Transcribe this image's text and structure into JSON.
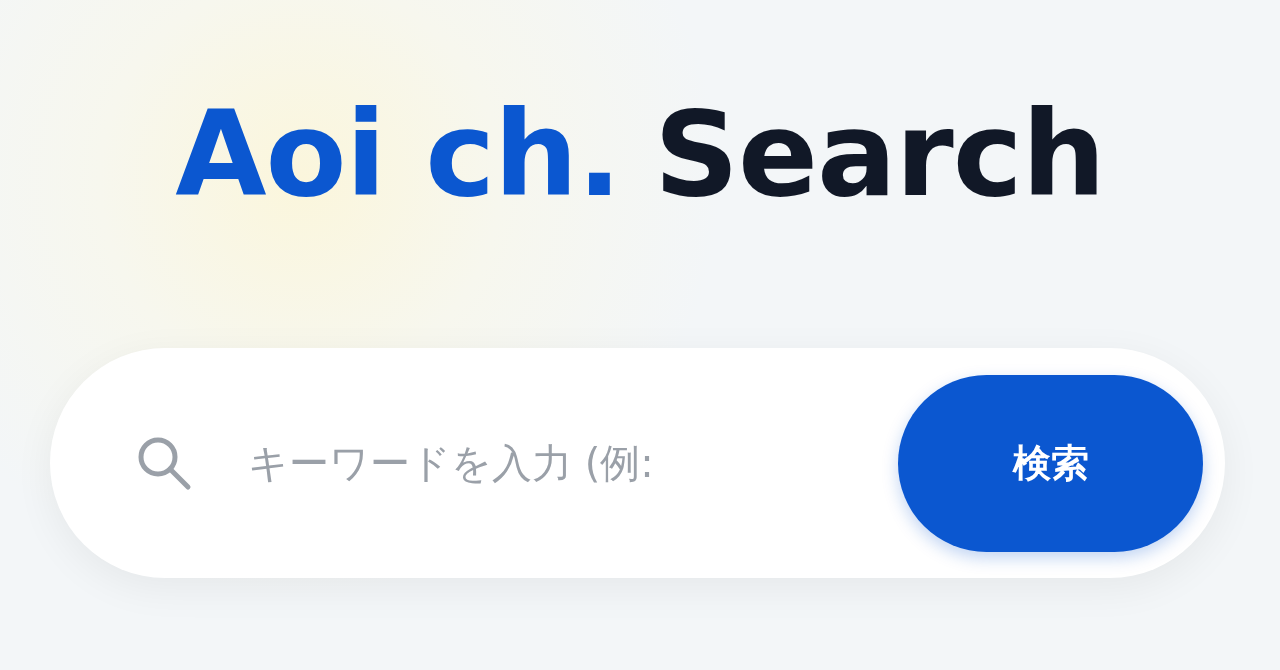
{
  "logo": [
    {
      "text": "Aoi ch.",
      "kind": "brand"
    },
    {
      "text": "Search",
      "kind": "plain"
    }
  ],
  "search": {
    "placeholder": "キーワードを入力 (例: ",
    "button": "検索"
  }
}
